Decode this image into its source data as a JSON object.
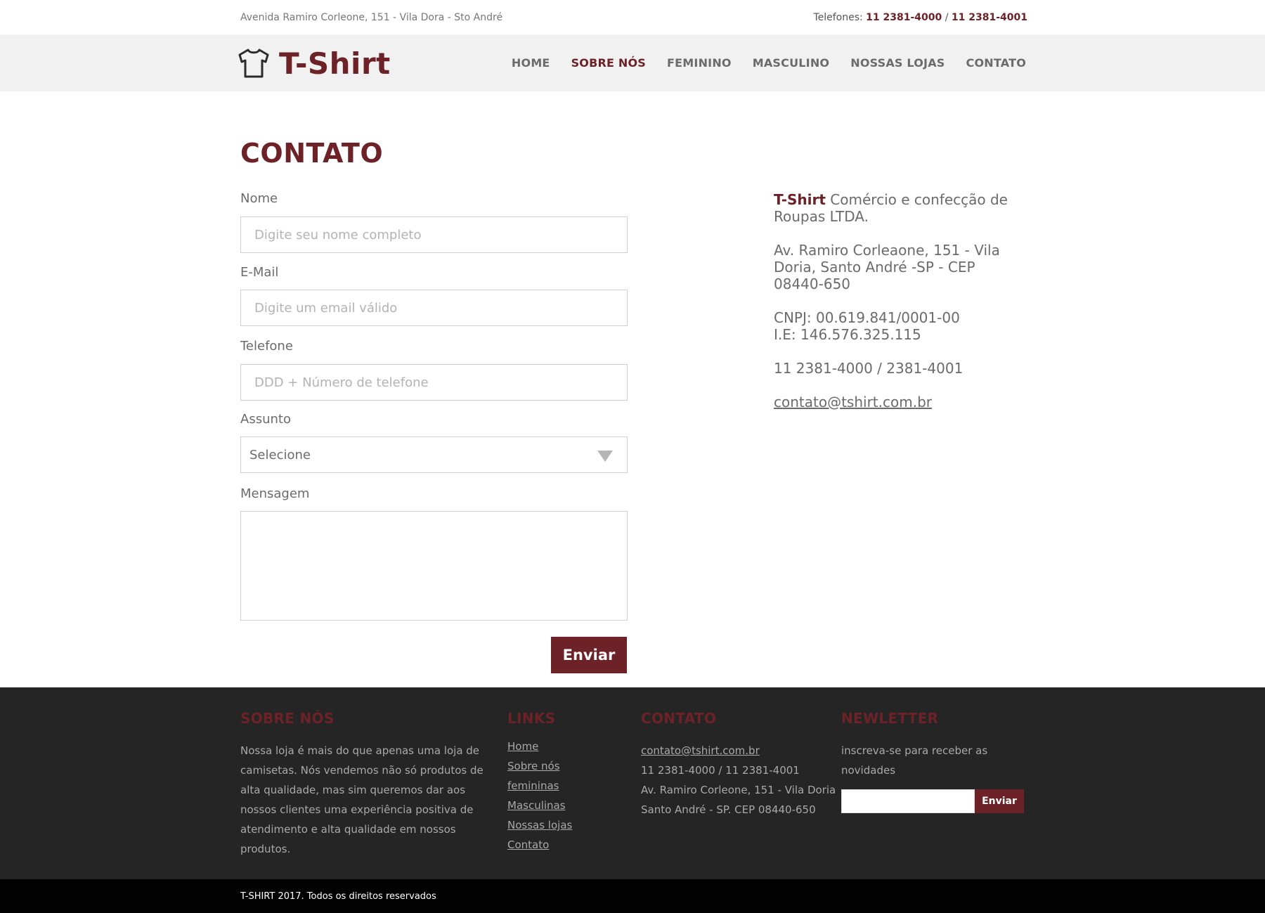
{
  "topbar": {
    "address": "Avenida Ramiro Corleone, 151 - Vila Dora - Sto André",
    "phones_label": "Telefones:",
    "phone1": "11 2381-4000",
    "separator": "/",
    "phone2": "11 2381-4001"
  },
  "header": {
    "logo_icon": "tshirt-icon",
    "logo_text": "T-Shirt",
    "nav": [
      {
        "label": "HOME",
        "active": false
      },
      {
        "label": "SOBRE NÓS",
        "active": true
      },
      {
        "label": "FEMININO",
        "active": false
      },
      {
        "label": "MASCULINO",
        "active": false
      },
      {
        "label": "NOSSAS LOJAS",
        "active": false
      },
      {
        "label": "CONTATO",
        "active": false
      }
    ]
  },
  "main": {
    "title": "CONTATO",
    "form": {
      "nome_label": "Nome",
      "nome_placeholder": "Digite seu nome completo",
      "email_label": "E-Mail",
      "email_placeholder": "Digite um email válido",
      "telefone_label": "Telefone",
      "telefone_placeholder": "DDD + Número de telefone",
      "assunto_label": "Assunto",
      "assunto_value": "Selecione",
      "mensagem_label": "Mensagem",
      "mensagem_value": "",
      "submit_label": "Enviar"
    },
    "info": {
      "brand": "T-Shirt",
      "company": "Comércio e confecção de Roupas LTDA.",
      "address": "Av. Ramiro Corleaone, 151 - Vila Doria, Santo André -SP - CEP 08440-650",
      "cnpj": "CNPJ: 00.619.841/0001-00",
      "ie": "I.E: 146.576.325.115",
      "phones": "11 2381-4000 / 2381-4001",
      "email": "contato@tshirt.com.br"
    }
  },
  "footer": {
    "about": {
      "title": "SOBRE NÓS",
      "text": "Nossa loja é mais do que apenas uma loja de camisetas. Nós vendemos não só produtos de alta qualidade, mas sim queremos dar aos nossos clientes uma experiência positiva de atendimento e alta qualidade em nossos produtos."
    },
    "links": {
      "title": "LINKS",
      "items": [
        "Home",
        "Sobre nós",
        "femininas",
        "Masculinas",
        "Nossas lojas",
        "Contato"
      ]
    },
    "contact": {
      "title": "CONTATO",
      "email": "contato@tshirt.com.br",
      "phones": "11 2381-4000 / 11 2381-4001",
      "address1": "Av. Ramiro Corleone, 151 - Vila Doria",
      "address2": "Santo André - SP. CEP 08440-650"
    },
    "newsletter": {
      "title": "NEWLETTER",
      "text": "inscreva-se para receber as novidades",
      "input_value": "",
      "button_label": "Enviar"
    }
  },
  "bottombar": {
    "copyright": "T-SHIRT 2017. Todos os direitos reservados"
  },
  "colors": {
    "brand": "#6d2227",
    "footer_bg": "#252525",
    "header_bg": "#f1f1f1"
  }
}
